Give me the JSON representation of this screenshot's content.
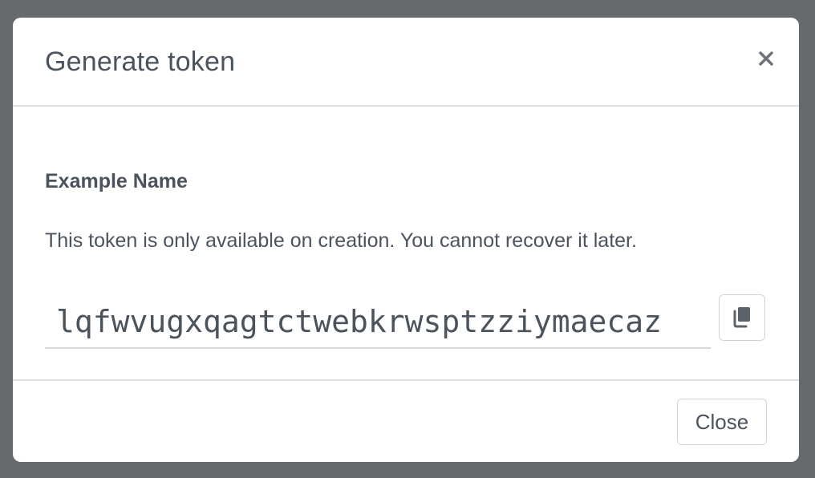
{
  "dialog": {
    "title": "Generate token",
    "close_icon": "close-icon",
    "token_name": "Example Name",
    "note": "This token is only available on creation. You cannot recover it later.",
    "token_value": "lqfwvugxqagtctwebkrwsptzziymaecaz",
    "copy_icon": "copy-icon",
    "close_label": "Close"
  },
  "colors": {
    "backdrop": "#676a6c",
    "text": "#4b535d",
    "border": "#dcdfe3"
  }
}
